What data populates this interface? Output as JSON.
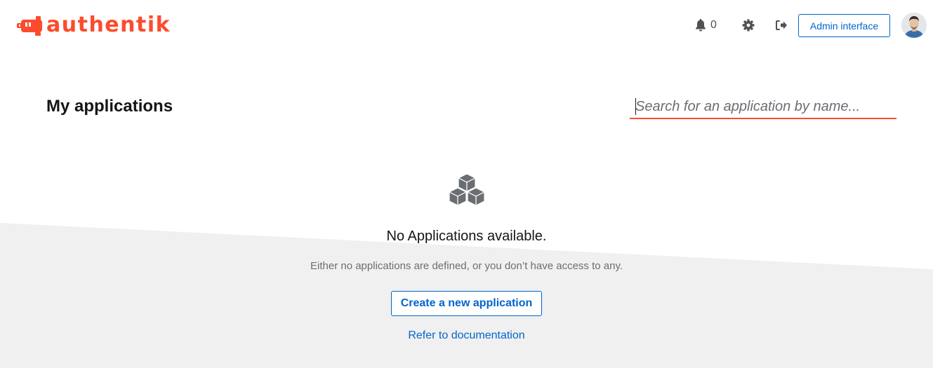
{
  "brand": {
    "name": "authentik",
    "accent_color": "#fd4b2d"
  },
  "header": {
    "notifications_count": "0",
    "notifications_icon": "bell-icon",
    "settings_icon": "gear-icon",
    "logout_icon": "sign-out-icon",
    "admin_button_label": "Admin interface",
    "avatar": "user-avatar"
  },
  "main": {
    "title": "My applications",
    "search_placeholder": "Search for an application by name..."
  },
  "empty_state": {
    "icon": "cubes-icon",
    "title": "No Applications available.",
    "body": "Either no applications are defined, or you don’t have access to any.",
    "create_button_label": "Create a new application",
    "docs_link_label": "Refer to documentation"
  },
  "colors": {
    "link": "#0066cc",
    "background_band": "#f0f0f0"
  }
}
